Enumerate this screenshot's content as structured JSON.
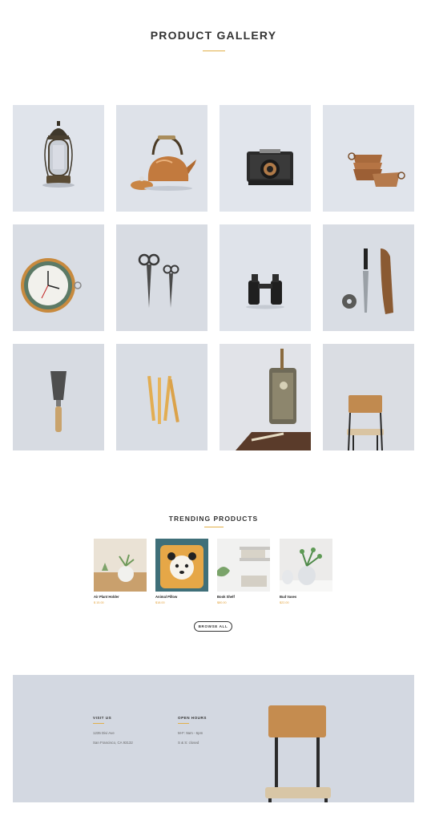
{
  "header": {
    "title": "PRODUCT GALLERY"
  },
  "gallery": {
    "items": [
      {
        "icon": "lantern-icon"
      },
      {
        "icon": "copper-kettle-icon"
      },
      {
        "icon": "vintage-camera-icon"
      },
      {
        "icon": "copper-cups-icon"
      },
      {
        "icon": "wall-clock-icon"
      },
      {
        "icon": "scissors-icon"
      },
      {
        "icon": "binoculars-icon"
      },
      {
        "icon": "knife-sheath-icon"
      },
      {
        "icon": "putty-knife-icon"
      },
      {
        "icon": "folding-ruler-icon"
      },
      {
        "icon": "sewing-machine-icon"
      },
      {
        "icon": "wooden-chair-icon"
      }
    ]
  },
  "trending": {
    "title": "TRENDING PRODUCTS",
    "products": [
      {
        "name": "Air Plant Holder",
        "price": "$ 15.00"
      },
      {
        "name": "Animal Pillow",
        "price": "$18.00"
      },
      {
        "name": "Book Shelf",
        "price": "$80.00"
      },
      {
        "name": "Bud Vases",
        "price": "$22.00"
      }
    ],
    "browse_label": "BROWSE ALL"
  },
  "footer": {
    "visit": {
      "heading": "VISIT US",
      "line1": "1235 Divi Ave",
      "line2": "San Francisco, CA 93132"
    },
    "hours": {
      "heading": "OPEN HOURS",
      "line1": "M-F: 9am - 6pm",
      "line2": "S & S: closed"
    }
  },
  "colors": {
    "accent": "#e2b04a",
    "tile_bg": "#dfe3ea",
    "footer_bg": "#d3d8e1"
  }
}
